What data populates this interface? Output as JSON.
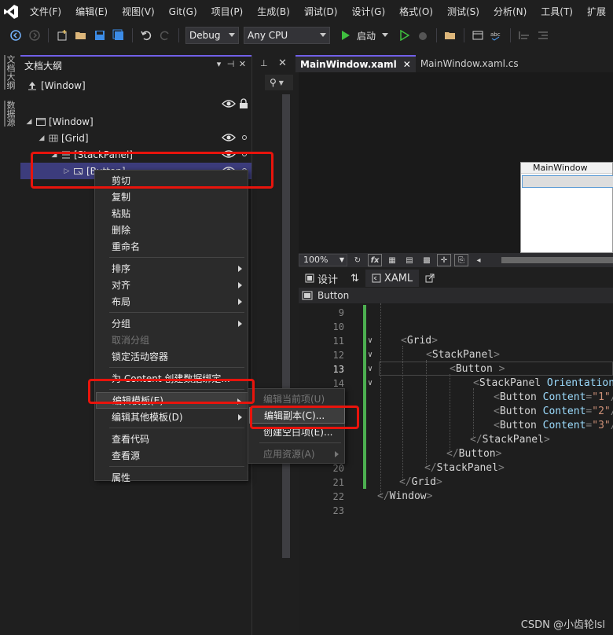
{
  "menubar": {
    "items": [
      "文件(F)",
      "编辑(E)",
      "视图(V)",
      "Git(G)",
      "项目(P)",
      "生成(B)",
      "调试(D)",
      "设计(G)",
      "格式(O)",
      "测试(S)",
      "分析(N)",
      "工具(T)",
      "扩展"
    ]
  },
  "toolbar": {
    "config_value": "Debug",
    "platform_value": "Any CPU",
    "start_label": "启动"
  },
  "vtabs": [
    "文档大纲",
    "数据源"
  ],
  "outline": {
    "title": "文档大纲",
    "root_label": "[Window]",
    "tree": [
      {
        "label": "[Window]",
        "expanded": true
      },
      {
        "label": "[Grid]",
        "expanded": true
      },
      {
        "label": "[StackPanel]",
        "expanded": true
      },
      {
        "label": "[Button]",
        "expanded": false,
        "selected": true
      }
    ]
  },
  "doctabs": [
    {
      "label": "MainWindow.xaml",
      "active": true
    },
    {
      "label": "MainWindow.xaml.cs",
      "active": false
    }
  ],
  "designer": {
    "window_title": "MainWindow",
    "zoom": "100%"
  },
  "splittabs": {
    "design": "设计",
    "swap": "⇅",
    "xaml": "XAML"
  },
  "breadcrumb": "Button",
  "editor": {
    "current_line": 13,
    "lines": [
      {
        "n": 9,
        "tokens": []
      },
      {
        "n": 10,
        "tokens": []
      },
      {
        "n": 11,
        "tokens": [
          [
            "br",
            "<"
          ],
          [
            "tag",
            "Grid"
          ],
          [
            "br",
            ">"
          ]
        ]
      },
      {
        "n": 12,
        "tokens": [
          [
            "br",
            "<"
          ],
          [
            "tag",
            "StackPanel"
          ],
          [
            "br",
            ">"
          ]
        ]
      },
      {
        "n": 13,
        "tokens": [
          [
            "br",
            "<"
          ],
          [
            "tag",
            "Button "
          ],
          [
            "br",
            ">"
          ]
        ]
      },
      {
        "n": 14,
        "tokens": [
          [
            "br",
            "<"
          ],
          [
            "tag",
            "StackPanel "
          ],
          [
            "attr",
            "Orientation"
          ],
          [
            "br",
            "=\""
          ]
        ]
      },
      {
        "n": 15,
        "tokens": [
          [
            "br",
            "<"
          ],
          [
            "tag",
            "Button "
          ],
          [
            "attr",
            "Content"
          ],
          [
            "br",
            "="
          ],
          [
            "val",
            "\"1\""
          ],
          [
            "br",
            "/>"
          ]
        ]
      },
      {
        "n": 16,
        "tokens": [
          [
            "br",
            "<"
          ],
          [
            "tag",
            "Button "
          ],
          [
            "attr",
            "Content"
          ],
          [
            "br",
            "="
          ],
          [
            "val",
            "\"2\""
          ],
          [
            "br",
            "/>"
          ]
        ]
      },
      {
        "n": 17,
        "tokens": [
          [
            "br",
            "<"
          ],
          [
            "tag",
            "Button "
          ],
          [
            "attr",
            "Content"
          ],
          [
            "br",
            "="
          ],
          [
            "val",
            "\"3\""
          ],
          [
            "br",
            "/>"
          ]
        ]
      },
      {
        "n": 18,
        "tokens": [
          [
            "br",
            "</"
          ],
          [
            "tag",
            "StackPanel"
          ],
          [
            "br",
            ">"
          ]
        ]
      },
      {
        "n": 19,
        "tokens": [
          [
            "br",
            "</"
          ],
          [
            "tag",
            "Button"
          ],
          [
            "br",
            ">"
          ]
        ]
      },
      {
        "n": 20,
        "tokens": [
          [
            "br",
            "</"
          ],
          [
            "tag",
            "StackPanel"
          ],
          [
            "br",
            ">"
          ]
        ]
      },
      {
        "n": 21,
        "tokens": [
          [
            "br",
            "</"
          ],
          [
            "tag",
            "Grid"
          ],
          [
            "br",
            ">"
          ]
        ]
      },
      {
        "n": 22,
        "tokens": [
          [
            "br",
            "</"
          ],
          [
            "tag",
            "Window"
          ],
          [
            "br",
            ">"
          ]
        ]
      },
      {
        "n": 23,
        "tokens": []
      }
    ]
  },
  "context_menu": {
    "items": [
      {
        "label": "剪切"
      },
      {
        "label": "复制"
      },
      {
        "label": "粘贴"
      },
      {
        "label": "删除"
      },
      {
        "label": "重命名"
      },
      {
        "sep": true
      },
      {
        "label": "排序",
        "submenu": true
      },
      {
        "label": "对齐",
        "submenu": true
      },
      {
        "label": "布局",
        "submenu": true
      },
      {
        "sep": true
      },
      {
        "label": "分组",
        "submenu": true
      },
      {
        "label": "取消分组",
        "disabled": true
      },
      {
        "label": "锁定活动容器"
      },
      {
        "sep": true
      },
      {
        "label": "为 Content 创建数据绑定..."
      },
      {
        "sep": true
      },
      {
        "label": "编辑模板(E)",
        "submenu": true,
        "highlighted": true
      },
      {
        "label": "编辑其他模板(D)",
        "submenu": true
      },
      {
        "sep": true
      },
      {
        "label": "查看代码"
      },
      {
        "label": "查看源"
      },
      {
        "sep": true
      },
      {
        "label": "属性"
      }
    ]
  },
  "submenu": {
    "items": [
      {
        "label": "编辑当前项(U)",
        "disabled": true
      },
      {
        "label": "编辑副本(C)...",
        "highlighted": true
      },
      {
        "label": "创建空白项(E)..."
      },
      {
        "sep": true
      },
      {
        "label": "应用资源(A)",
        "disabled": true,
        "submenu": true
      }
    ]
  },
  "watermark": "CSDN @小齿轮lsl",
  "colors": {
    "accent": "#7160e8",
    "annotation_red": "#e8140c",
    "selection": "#3c3c7c",
    "editor_bg": "#1e1e1e"
  }
}
